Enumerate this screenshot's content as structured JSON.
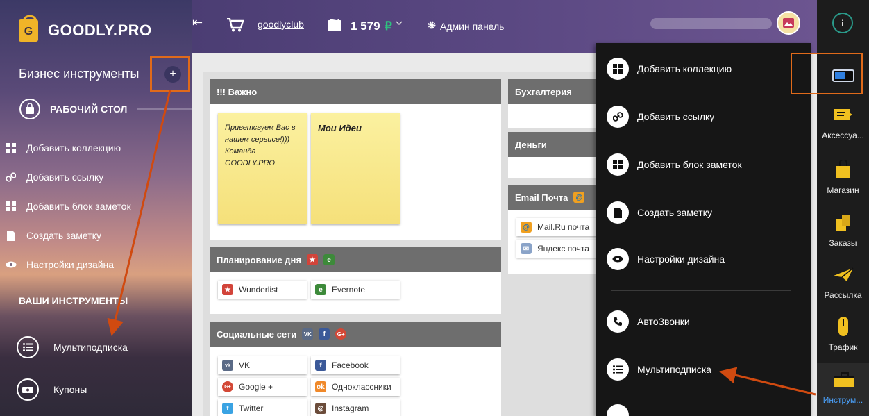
{
  "brand": {
    "logo_letter": "G",
    "name": "GOODLY.PRO"
  },
  "sidebar": {
    "section_title": "Бизнес инструменты",
    "add_symbol": "+",
    "desk_label": "РАБОЧИЙ СТОЛ",
    "items": [
      {
        "label": "Добавить коллекцию",
        "icon": "grid-icon"
      },
      {
        "label": "Добавить ссылку",
        "icon": "link-icon"
      },
      {
        "label": "Добавить блок заметок",
        "icon": "grid-icon"
      },
      {
        "label": "Создать заметку",
        "icon": "note-icon"
      },
      {
        "label": "Настройки дизайна",
        "icon": "eye-icon"
      }
    ],
    "tools_label": "ВАШИ ИНСТРУМЕНТЫ",
    "tools": [
      {
        "label": "Мультиподписка",
        "icon": "list-icon"
      },
      {
        "label": "Купоны",
        "icon": "coupon-icon"
      }
    ]
  },
  "topbar": {
    "collapse_symbol": "⇤",
    "shop_link": "goodlyclub",
    "balance": "1 579",
    "currency": "₽",
    "admin_link": "Админ панель"
  },
  "panels": {
    "important": {
      "title": "!!! Важно",
      "notes": [
        {
          "text": "Приветсвуем Вас в нашем сервисе!))) Команда GOODLY.PRO"
        },
        {
          "text": "Мои Идеи"
        }
      ]
    },
    "planning": {
      "title": "Планирование дня",
      "links": [
        "Wunderlist",
        "Evernote"
      ]
    },
    "social": {
      "title": "Социальные сети",
      "header_icons": [
        "VK",
        "f",
        "G+"
      ],
      "links": [
        "VK",
        "Facebook",
        "Google +",
        "Одноклассники",
        "Twitter",
        "Instagram"
      ]
    },
    "accounting": {
      "title": "Бухгалтерия"
    },
    "money": {
      "title": "Деньги"
    },
    "email": {
      "title": "Email Почта",
      "links": [
        "Mail.Ru почта",
        "Яндекс почта"
      ]
    }
  },
  "dropdown": {
    "items": [
      {
        "label": "Добавить коллекцию",
        "icon": "grid-icon"
      },
      {
        "label": "Добавить ссылку",
        "icon": "link-icon"
      },
      {
        "label": "Добавить блок заметок",
        "icon": "grid-icon"
      },
      {
        "label": "Создать заметку",
        "icon": "note-icon"
      },
      {
        "label": "Настройки дизайна",
        "icon": "eye-icon"
      },
      {
        "label": "АвтоЗвонки",
        "icon": "phone-icon"
      },
      {
        "label": "Мультиподписка",
        "icon": "list-icon"
      }
    ]
  },
  "rail": {
    "info_symbol": "i",
    "items": [
      {
        "label": "Аксессуа...",
        "icon": "accessories-icon"
      },
      {
        "label": "Магазин",
        "icon": "shop-bag-icon"
      },
      {
        "label": "Заказы",
        "icon": "orders-icon"
      },
      {
        "label": "Рассылка",
        "icon": "mail-plane-icon"
      },
      {
        "label": "Трафик",
        "icon": "traffic-icon"
      },
      {
        "label": "Инструм...",
        "icon": "toolbox-icon"
      }
    ]
  },
  "colors": {
    "accent_orange": "#e06a1a",
    "rail_active": "#4ba3ff",
    "topbar": "#5a4882"
  }
}
